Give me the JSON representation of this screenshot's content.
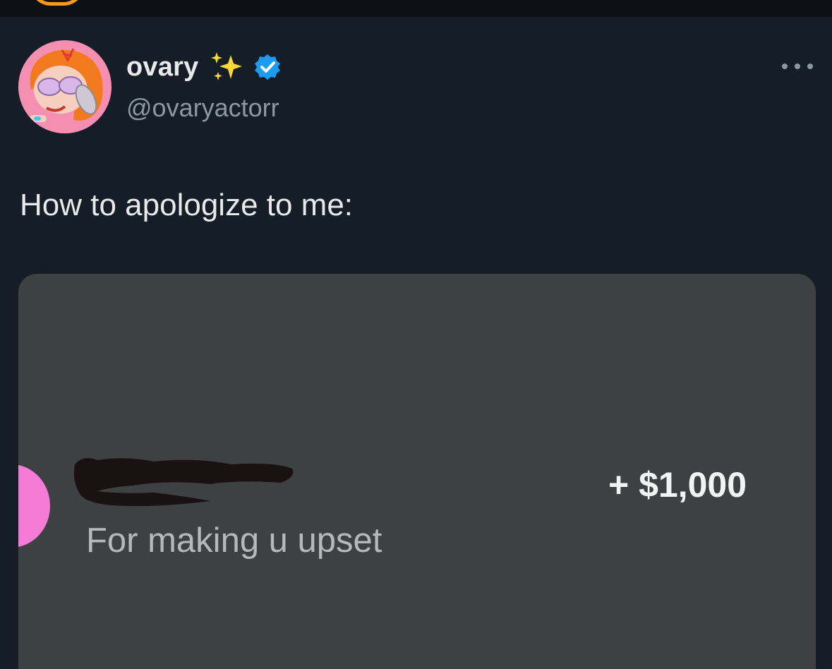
{
  "author": {
    "name": "ovary",
    "handle": "@ovaryactorr"
  },
  "icons": {
    "sparkles": "sparkles-emoji-icon",
    "verified": "verified-badge-icon",
    "more": "more-options-icon"
  },
  "colors": {
    "background": "#151d26",
    "verified": "#1d9bf0",
    "media_background": "#3e4141"
  },
  "tweet": {
    "text": "How to apologize to me:"
  },
  "media": {
    "memo": "For making u upset",
    "amount": "+ $1,000"
  }
}
